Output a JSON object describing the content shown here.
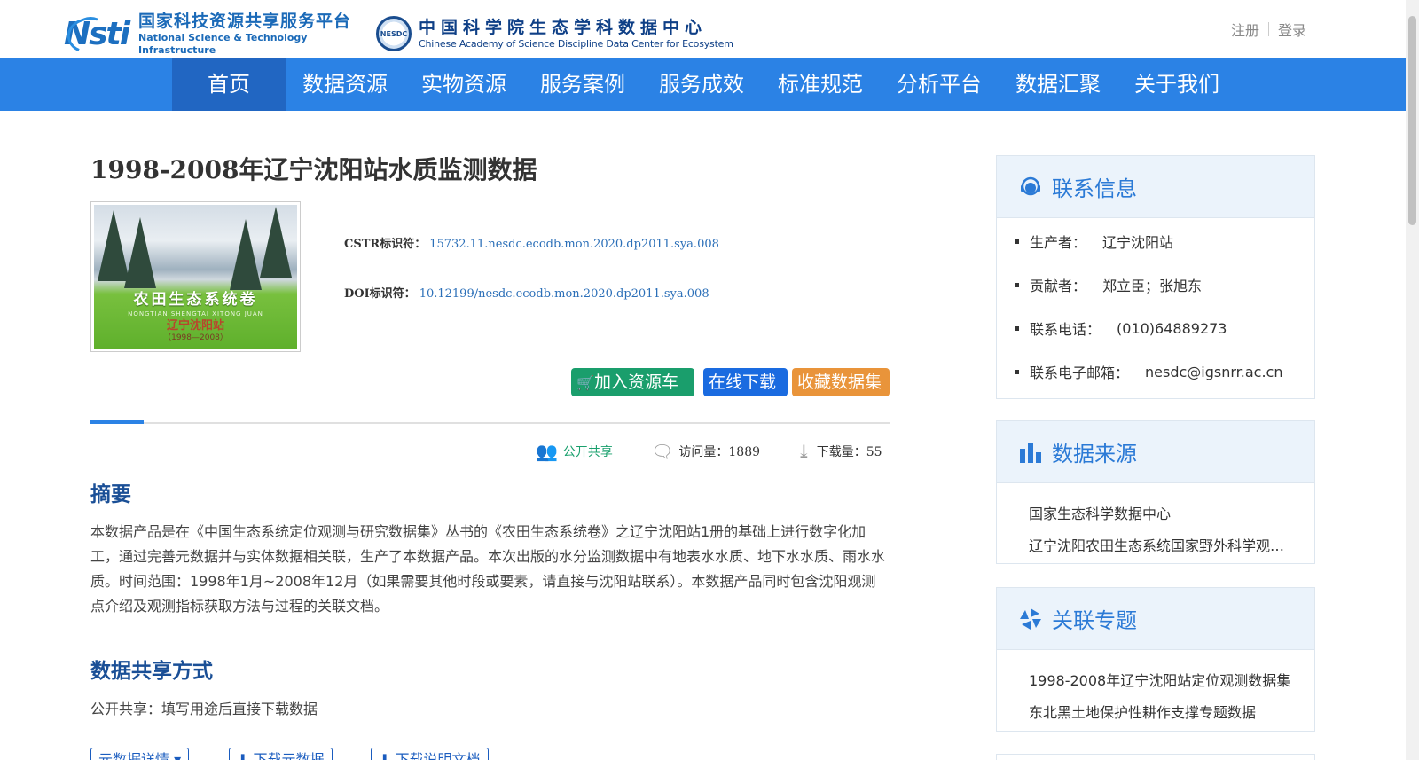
{
  "header": {
    "logo1_cn": "国家科技资源共享服务平台",
    "logo1_en": "National Science & Technology Infrastructure",
    "logo1_mark": "Nsti",
    "logo2_seal": "NESDC",
    "logo2_cn": "中国科学院生态学科数据中心",
    "logo2_en": "Chinese Academy of Science Discipline Data Center for Ecosystem",
    "register": "注册",
    "login": "登录"
  },
  "nav": {
    "items": [
      "首页",
      "数据资源",
      "实物资源",
      "服务案例",
      "服务成效",
      "标准规范",
      "分析平台",
      "数据汇聚",
      "关于我们"
    ]
  },
  "dataset": {
    "title": "1998-2008年辽宁沈阳站水质监测数据",
    "cover": {
      "line1": "农田生态系统卷",
      "line2": "NONGTIAN SHENGTAI XITONG JUAN",
      "line3": "辽宁沈阳站",
      "line4": "（1998—2008）"
    },
    "cstr_label": "CSTR标识符：",
    "cstr_value": "15732.11.nesdc.ecodb.mon.2020.dp2011.sya.008",
    "doi_label": "DOI标识符：",
    "doi_value": "10.12199/nesdc.ecodb.mon.2020.dp2011.sya.008",
    "btn_cart": "加入资源车",
    "btn_download": "在线下载",
    "btn_favorite": "收藏数据集",
    "share_status": "公开共享",
    "visits": "访问量：1889",
    "downloads": "下载量：55",
    "abstract_title": "摘要",
    "abstract_text": "本数据产品是在《中国生态系统定位观测与研究数据集》丛书的《农田生态系统卷》之辽宁沈阳站1册的基础上进行数字化加工，通过完善元数据并与实体数据相关联，生产了本数据产品。本次出版的水分监测数据中有地表水水质、地下水水质、雨水水质。时间范围：1998年1月~2008年12月（如果需要其他时段或要素，请直接与沈阳站联系）。本数据产品同时包含沈阳观测点介绍及观测指标获取方法与过程的关联文档。",
    "share_title": "数据共享方式",
    "share_text": "公开共享：填写用途后直接下载数据",
    "btn_meta": "元数据详情 ▾",
    "btn_meta_download": "⬇ 下载元数据",
    "btn_doc_download": "⬇ 下载说明文档"
  },
  "sidebar": {
    "contact_title": "联系信息",
    "contact": [
      {
        "label": "生产者：",
        "value": "辽宁沈阳站"
      },
      {
        "label": "贡献者：",
        "value": "郑立臣；张旭东"
      },
      {
        "label": "联系电话：",
        "value": "(010)64889273"
      },
      {
        "label": "联系电子邮箱：",
        "value": "nesdc@igsnrr.ac.cn"
      }
    ],
    "source_title": "数据来源",
    "sources": [
      "国家生态科学数据中心",
      "辽宁沈阳农田生态系统国家野外科学观测研究站"
    ],
    "topic_title": "关联专题",
    "topics": [
      "1998-2008年辽宁沈阳站定位观测数据集",
      "东北黑土地保护性耕作支撑专题数据"
    ]
  },
  "colors": {
    "nav_bg": "#2b82e5",
    "nav_active": "#2166c2",
    "cart_btn": "#1a9e6c",
    "download_btn": "#1a6be0",
    "favorite_btn": "#e9943a",
    "heading": "#1a4f96"
  }
}
